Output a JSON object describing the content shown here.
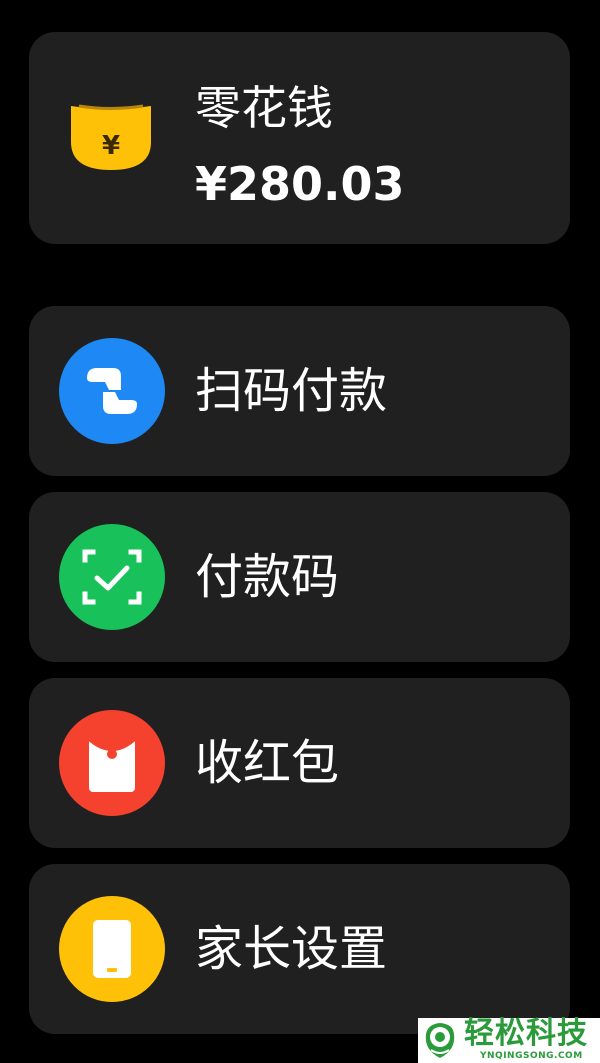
{
  "wallet": {
    "title": "零花钱",
    "balance": "¥280.03",
    "icon": "wallet-yen-icon",
    "icon_color": "#FFC107"
  },
  "menu": [
    {
      "label": "扫码付款",
      "icon": "scan-pay-icon",
      "color": "#1E88F5"
    },
    {
      "label": "付款码",
      "icon": "payment-code-icon",
      "color": "#19C15B"
    },
    {
      "label": "收红包",
      "icon": "red-envelope-icon",
      "color": "#F5422E"
    },
    {
      "label": "家长设置",
      "icon": "parent-settings-icon",
      "color": "#FFC107"
    }
  ],
  "watermark": {
    "title": "轻松科技",
    "subtitle": "YNQINGSONG.COM",
    "color": "#2A9A3A"
  },
  "theme": {
    "background": "#000000",
    "card": "#202020",
    "text": "#FFFFFF"
  }
}
